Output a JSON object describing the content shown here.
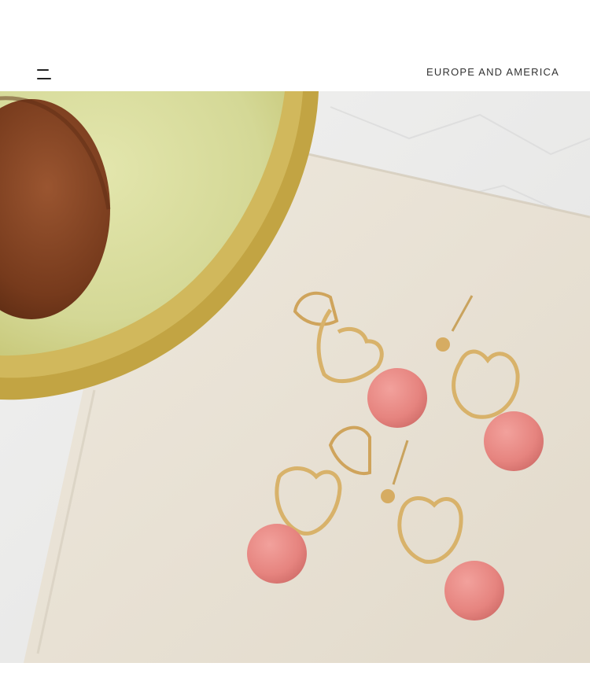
{
  "header": {
    "brand_text": "EUROPE AND AMERICA",
    "menu_icon": "hamburger-menu-icon"
  },
  "product_photo": {
    "subject_icons": [
      "avocado-half",
      "linen-cloth",
      "heart-hoop-earring",
      "pink-pompom"
    ],
    "colors": {
      "backdrop": "#ececeb",
      "linen": "#e9e2d6",
      "avocado_skin": "#c9b04a",
      "avocado_flesh": "#d8dc9c",
      "avocado_pit": "#7a3d1e",
      "gold": "#d8b26a",
      "pompom": "#e88a86"
    }
  }
}
